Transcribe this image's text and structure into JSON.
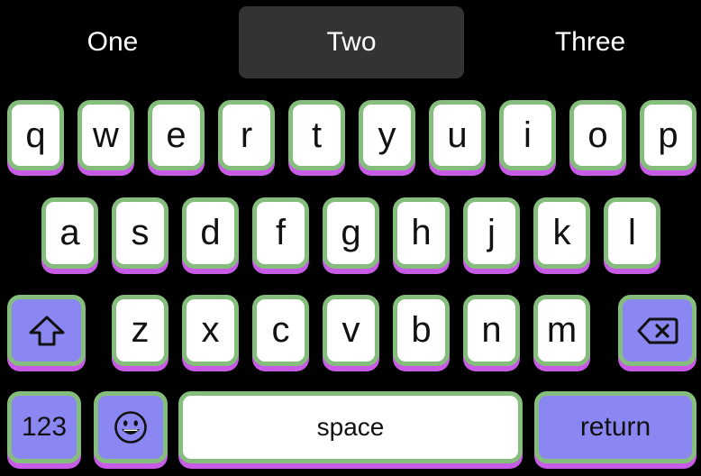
{
  "suggestions": [
    {
      "label": "One",
      "selected": false
    },
    {
      "label": "Two",
      "selected": true
    },
    {
      "label": "Three",
      "selected": false
    }
  ],
  "rows": {
    "row1": [
      "q",
      "w",
      "e",
      "r",
      "t",
      "y",
      "u",
      "i",
      "o",
      "p"
    ],
    "row2": [
      "a",
      "s",
      "d",
      "f",
      "g",
      "h",
      "j",
      "k",
      "l"
    ],
    "row3": [
      "z",
      "x",
      "c",
      "v",
      "b",
      "n",
      "m"
    ]
  },
  "keys": {
    "shift_icon": "shift-arrow-icon",
    "delete_icon": "backspace-icon",
    "numbers_label": "123",
    "emoji_icon": "emoji-face-icon",
    "space_label": "space",
    "return_label": "return"
  },
  "colors": {
    "background": "#000000",
    "key_fill": "#ffffff",
    "key_border": "#85bd7c",
    "key_shadow": "#c85be5",
    "function_key_fill": "#8b87f2",
    "selected_suggestion": "#333333"
  }
}
